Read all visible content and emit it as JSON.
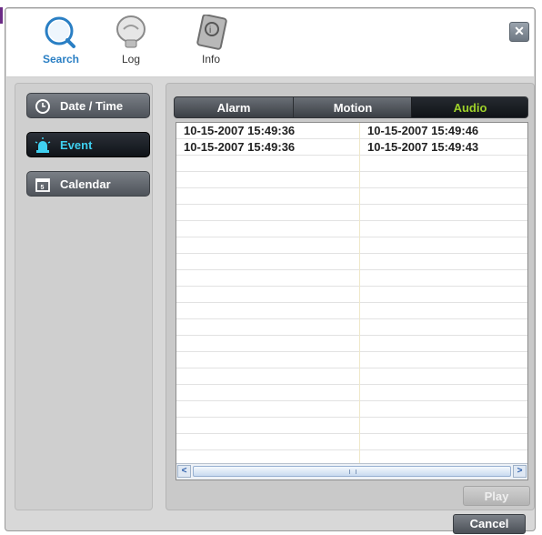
{
  "toolbar": {
    "search_label": "Search",
    "log_label": "Log",
    "info_label": "Info",
    "close_glyph": "✕"
  },
  "sidebar": {
    "items": [
      {
        "label": "Date / Time",
        "icon": "clock-icon"
      },
      {
        "label": "Event",
        "icon": "alarm-light-icon",
        "selected": true
      },
      {
        "label": "Calendar",
        "icon": "calendar-icon"
      }
    ]
  },
  "tabs": [
    {
      "label": "Alarm"
    },
    {
      "label": "Motion"
    },
    {
      "label": "Audio",
      "selected": true
    }
  ],
  "events": [
    {
      "start": "10-15-2007 15:49:36",
      "end": "10-15-2007 15:49:46"
    },
    {
      "start": "10-15-2007 15:49:36",
      "end": "10-15-2007 15:49:43"
    }
  ],
  "scroll": {
    "left_glyph": "<",
    "right_glyph": ">",
    "grip_glyph": "III"
  },
  "buttons": {
    "play": "Play",
    "cancel": "Cancel"
  },
  "colors": {
    "selected_tab_text": "#9fd22a",
    "selected_nav_text": "#3fd0f0",
    "search_label": "#2a7fc4"
  }
}
